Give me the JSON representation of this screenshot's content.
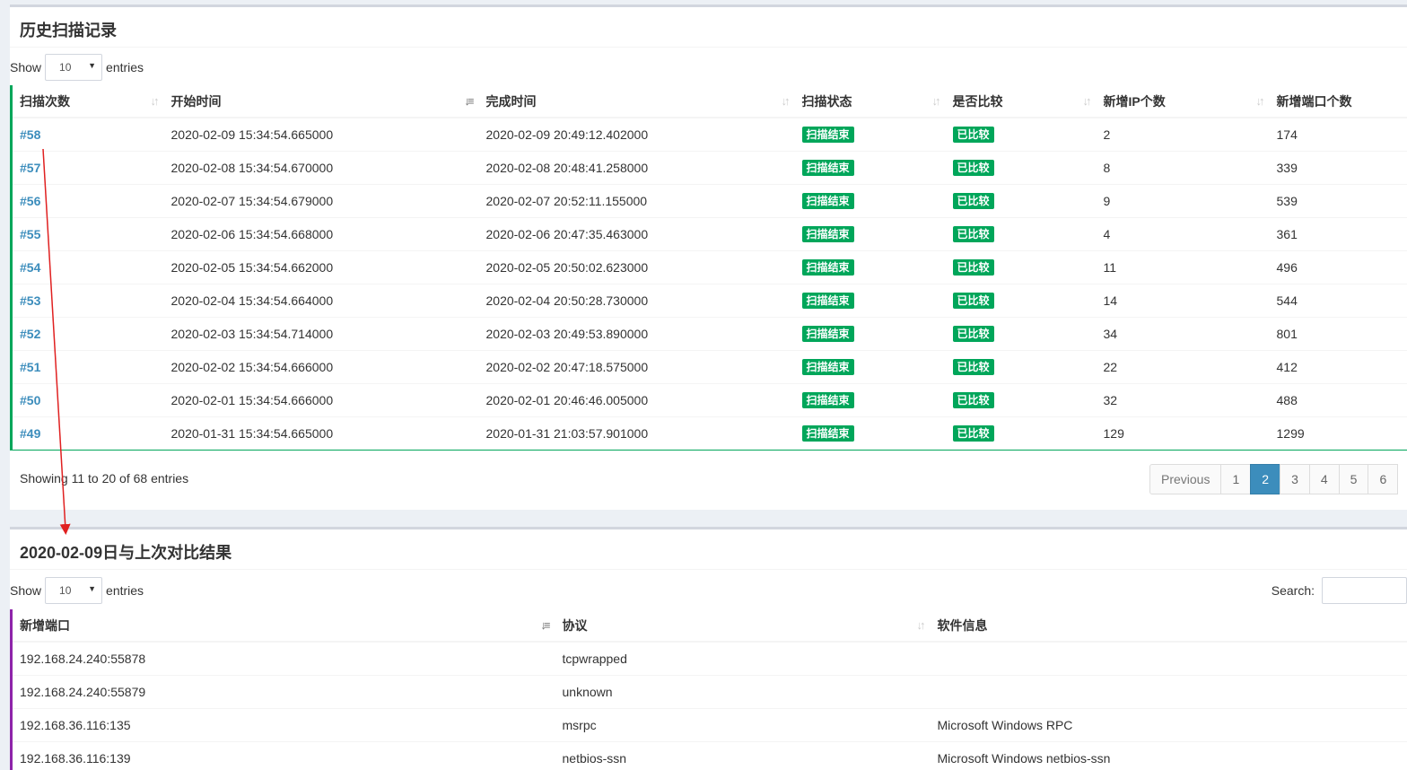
{
  "history": {
    "title": "历史扫描记录",
    "show_label": "Show",
    "page_size": "10",
    "entries_label": "entries",
    "columns": [
      "扫描次数",
      "开始时间",
      "完成时间",
      "扫描状态",
      "是否比较",
      "新增IP个数",
      "新增端口个数"
    ],
    "rows": [
      {
        "id": "#58",
        "start": "2020-02-09 15:34:54.665000",
        "end": "2020-02-09 20:49:12.402000",
        "status": "扫描结束",
        "compare": "已比较",
        "new_ip": "2",
        "new_port": "174"
      },
      {
        "id": "#57",
        "start": "2020-02-08 15:34:54.670000",
        "end": "2020-02-08 20:48:41.258000",
        "status": "扫描结束",
        "compare": "已比较",
        "new_ip": "8",
        "new_port": "339"
      },
      {
        "id": "#56",
        "start": "2020-02-07 15:34:54.679000",
        "end": "2020-02-07 20:52:11.155000",
        "status": "扫描结束",
        "compare": "已比较",
        "new_ip": "9",
        "new_port": "539"
      },
      {
        "id": "#55",
        "start": "2020-02-06 15:34:54.668000",
        "end": "2020-02-06 20:47:35.463000",
        "status": "扫描结束",
        "compare": "已比较",
        "new_ip": "4",
        "new_port": "361"
      },
      {
        "id": "#54",
        "start": "2020-02-05 15:34:54.662000",
        "end": "2020-02-05 20:50:02.623000",
        "status": "扫描结束",
        "compare": "已比较",
        "new_ip": "11",
        "new_port": "496"
      },
      {
        "id": "#53",
        "start": "2020-02-04 15:34:54.664000",
        "end": "2020-02-04 20:50:28.730000",
        "status": "扫描结束",
        "compare": "已比较",
        "new_ip": "14",
        "new_port": "544"
      },
      {
        "id": "#52",
        "start": "2020-02-03 15:34:54.714000",
        "end": "2020-02-03 20:49:53.890000",
        "status": "扫描结束",
        "compare": "已比较",
        "new_ip": "34",
        "new_port": "801"
      },
      {
        "id": "#51",
        "start": "2020-02-02 15:34:54.666000",
        "end": "2020-02-02 20:47:18.575000",
        "status": "扫描结束",
        "compare": "已比较",
        "new_ip": "22",
        "new_port": "412"
      },
      {
        "id": "#50",
        "start": "2020-02-01 15:34:54.666000",
        "end": "2020-02-01 20:46:46.005000",
        "status": "扫描结束",
        "compare": "已比较",
        "new_ip": "32",
        "new_port": "488"
      },
      {
        "id": "#49",
        "start": "2020-01-31 15:34:54.665000",
        "end": "2020-01-31 21:03:57.901000",
        "status": "扫描结束",
        "compare": "已比较",
        "new_ip": "129",
        "new_port": "1299"
      }
    ],
    "info": "Showing 11 to 20 of 68 entries",
    "pager": {
      "previous": "Previous",
      "pages": [
        "1",
        "2",
        "3",
        "4",
        "5",
        "6"
      ],
      "active": "2"
    },
    "colors": {
      "accent": "#00a65a",
      "link": "#3c8dbc"
    }
  },
  "compare": {
    "title": "2020-02-09日与上次对比结果",
    "show_label": "Show",
    "page_size": "10",
    "entries_label": "entries",
    "search_label": "Search:",
    "columns": [
      "新增端口",
      "协议",
      "软件信息"
    ],
    "rows": [
      {
        "port": "192.168.24.240:55878",
        "proto": "tcpwrapped",
        "software": ""
      },
      {
        "port": "192.168.24.240:55879",
        "proto": "unknown",
        "software": ""
      },
      {
        "port": "192.168.36.116:135",
        "proto": "msrpc",
        "software": "Microsoft Windows RPC"
      },
      {
        "port": "192.168.36.116:139",
        "proto": "netbios-ssn",
        "software": "Microsoft Windows netbios-ssn"
      }
    ],
    "colors": {
      "accent": "#8e24aa"
    }
  },
  "annotation": {
    "color": "#e02020"
  }
}
